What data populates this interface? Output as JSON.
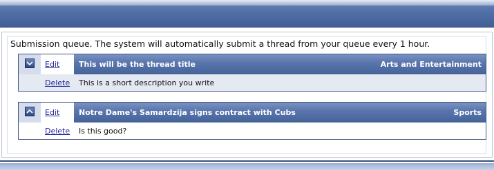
{
  "queue": {
    "intro_text": "Submission queue. The system will automatically submit a thread from your queue every 1 hour.",
    "items": [
      {
        "icon": "arrow-down-icon",
        "edit_label": "Edit",
        "delete_label": "Delete",
        "title": "This will be the thread title",
        "category": "Arts and Entertainment",
        "description": "This is a short description you write"
      },
      {
        "icon": "arrow-up-icon",
        "edit_label": "Edit",
        "delete_label": "Delete",
        "title": "Notre Dame's Samardzija signs contract with Cubs",
        "category": "Sports",
        "description": "Is this good?"
      }
    ]
  },
  "colors": {
    "header_blue": "#5170a6",
    "link": "#22229a",
    "row_alt": "#e4e9f2"
  }
}
